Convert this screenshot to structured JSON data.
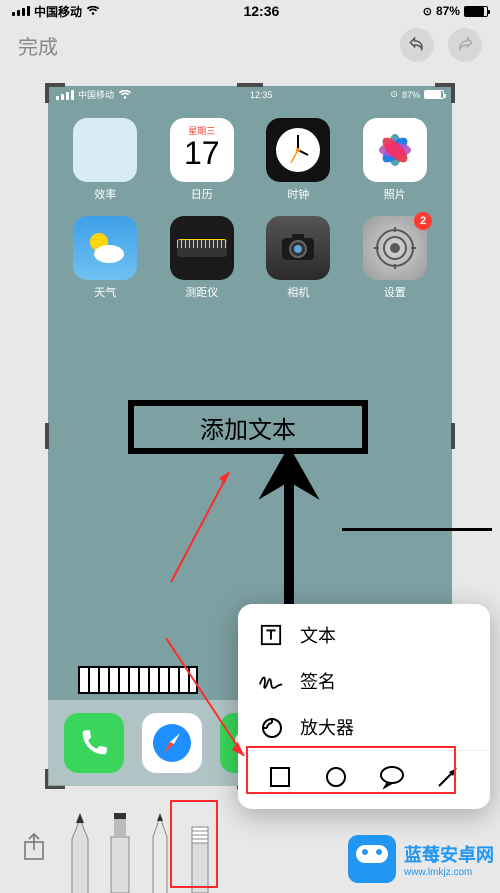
{
  "status": {
    "carrier": "中国移动",
    "time": "12:36",
    "battery_pct": "87%",
    "alarm": "⏰"
  },
  "nav": {
    "done": "完成"
  },
  "inner_status": {
    "carrier": "中国移动",
    "time": "12:35",
    "battery_pct": "87%"
  },
  "apps": [
    {
      "label": "效率",
      "bg": "#d7ecf5"
    },
    {
      "label": "日历",
      "cal_day": "星期三",
      "cal_date": "17"
    },
    {
      "label": "时钟",
      "bg": "#111"
    },
    {
      "label": "照片",
      "bg": "#fff"
    },
    {
      "label": "天气",
      "bg": "linear-gradient(#3fa0e8,#6fc1f2)"
    },
    {
      "label": "测距仪",
      "bg": "#1a1a1a"
    },
    {
      "label": "相机",
      "bg": "#3a3a3a"
    },
    {
      "label": "设置",
      "bg": "#bfbfbf",
      "badge": "2"
    }
  ],
  "dock": [
    {
      "bg": "#39d65b"
    },
    {
      "bg": "#fff"
    },
    {
      "bg": "#39d65b"
    }
  ],
  "textbox": "添加文本",
  "menu": {
    "text": "文本",
    "signature": "签名",
    "magnifier": "放大器"
  },
  "watermark": {
    "title": "蓝莓安卓网",
    "url": "www.lmkjz.com"
  }
}
